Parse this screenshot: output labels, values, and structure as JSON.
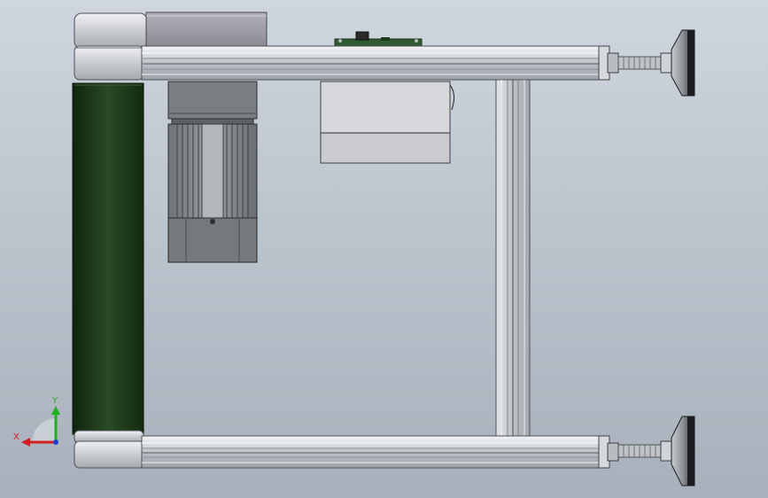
{
  "view": {
    "background_top": "#cfd6df",
    "background_bottom": "#a8b0bb"
  },
  "model": {
    "belt_color": "#1f3b1c",
    "aluminum_color": "#c4c7cc",
    "motor_color": "#8d9096",
    "pcb_color": "#2f5a32",
    "parts": [
      "head-pulley-top",
      "head-pulley-bottom",
      "conveyor-belt",
      "gear-motor",
      "motor-bracket-plate",
      "control-box",
      "pcb-board",
      "top-aluminum-rail",
      "bottom-aluminum-rail",
      "vertical-support-profile",
      "leveling-foot-top",
      "leveling-foot-bottom"
    ]
  },
  "triad": {
    "x_label": "X",
    "y_label": "Y",
    "x_color": "#d21f1f",
    "y_color": "#1fb01f",
    "z_color": "#1f3fd2"
  }
}
